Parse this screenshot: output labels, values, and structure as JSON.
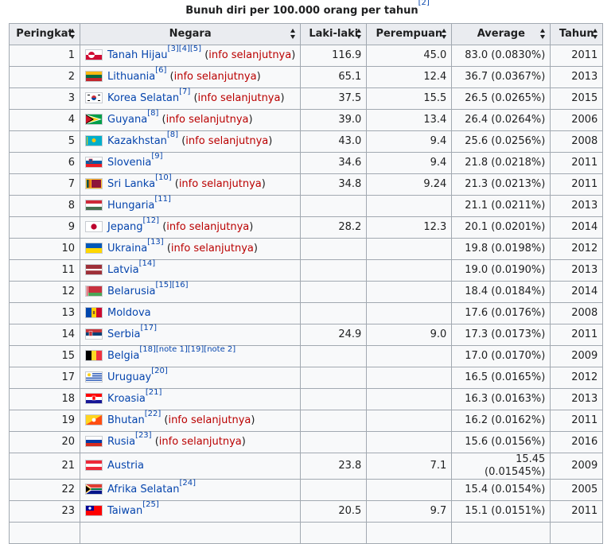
{
  "caption": {
    "text": "Bunuh diri per 100.000 orang per tahun",
    "ref": "[2]"
  },
  "columns": [
    "Peringkat",
    "Negara",
    "Laki-laki",
    "Perempuan",
    "Average",
    "Tahun"
  ],
  "info_text": "info selanjutnya",
  "rows": [
    {
      "rank": "1",
      "country": "Tanah Hijau",
      "refs": "[3][4][5]",
      "info": true,
      "male": "116.9",
      "female": "45.0",
      "avg": "83.0 (0.0830%)",
      "year": "2011",
      "flag": "greenland-flag"
    },
    {
      "rank": "2",
      "country": "Lithuania",
      "refs": "[6]",
      "info": true,
      "male": "65.1",
      "female": "12.4",
      "avg": "36.7 (0.0367%)",
      "year": "2013",
      "flag": "lithuania-flag"
    },
    {
      "rank": "3",
      "country": "Korea Selatan",
      "refs": "[7]",
      "info": true,
      "male": "37.5",
      "female": "15.5",
      "avg": "26.5 (0.0265%)",
      "year": "2015",
      "flag": "south-korea-flag"
    },
    {
      "rank": "4",
      "country": "Guyana",
      "refs": "[8]",
      "info": true,
      "male": "39.0",
      "female": "13.4",
      "avg": "26.4 (0.0264%)",
      "year": "2006",
      "flag": "guyana-flag"
    },
    {
      "rank": "5",
      "country": "Kazakhstan",
      "refs": "[8]",
      "info": true,
      "male": "43.0",
      "female": "9.4",
      "avg": "25.6 (0.0256%)",
      "year": "2008",
      "flag": "kazakhstan-flag"
    },
    {
      "rank": "6",
      "country": "Slovenia",
      "refs": "[9]",
      "info": false,
      "male": "34.6",
      "female": "9.4",
      "avg": "21.8 (0.0218%)",
      "year": "2011",
      "flag": "slovenia-flag"
    },
    {
      "rank": "7",
      "country": "Sri Lanka",
      "refs": "[10]",
      "info": true,
      "male": "34.8",
      "female": "9.24",
      "avg": "21.3 (0.0213%)",
      "year": "2011",
      "flag": "sri-lanka-flag"
    },
    {
      "rank": "8",
      "country": "Hungaria",
      "refs": "[11]",
      "info": false,
      "male": "",
      "female": "",
      "avg": "21.1 (0.0211%)",
      "year": "2013",
      "flag": "hungary-flag"
    },
    {
      "rank": "9",
      "country": "Jepang",
      "refs": "[12]",
      "info": true,
      "male": "28.2",
      "female": "12.3",
      "avg": "20.1 (0.0201%)",
      "year": "2014",
      "flag": "japan-flag"
    },
    {
      "rank": "10",
      "country": "Ukraina",
      "refs": "[13]",
      "info": true,
      "male": "",
      "female": "",
      "avg": "19.8 (0.0198%)",
      "year": "2012",
      "flag": "ukraine-flag"
    },
    {
      "rank": "11",
      "country": "Latvia",
      "refs": "[14]",
      "info": false,
      "male": "",
      "female": "",
      "avg": "19.0 (0.0190%)",
      "year": "2013",
      "flag": "latvia-flag"
    },
    {
      "rank": "12",
      "country": "Belarusia",
      "refs": "[15][16]",
      "info": false,
      "male": "",
      "female": "",
      "avg": "18.4 (0.0184%)",
      "year": "2014",
      "flag": "belarus-flag"
    },
    {
      "rank": "13",
      "country": "Moldova",
      "refs": "",
      "info": false,
      "male": "",
      "female": "",
      "avg": "17.6 (0.0176%)",
      "year": "2008",
      "flag": "moldova-flag"
    },
    {
      "rank": "14",
      "country": "Serbia",
      "refs": "[17]",
      "info": false,
      "male": "24.9",
      "female": "9.0",
      "avg": "17.3 (0.0173%)",
      "year": "2011",
      "flag": "serbia-flag"
    },
    {
      "rank": "15",
      "country": "Belgia",
      "refs": "[18][note 1][19][note 2]",
      "info": false,
      "male": "",
      "female": "",
      "avg": "17.0 (0.0170%)",
      "year": "2009",
      "flag": "belgium-flag"
    },
    {
      "rank": "17",
      "country": "Uruguay",
      "refs": "[20]",
      "info": false,
      "male": "",
      "female": "",
      "avg": "16.5 (0.0165%)",
      "year": "2012",
      "flag": "uruguay-flag"
    },
    {
      "rank": "18",
      "country": "Kroasia",
      "refs": "[21]",
      "info": false,
      "male": "",
      "female": "",
      "avg": "16.3 (0.0163%)",
      "year": "2013",
      "flag": "croatia-flag"
    },
    {
      "rank": "19",
      "country": "Bhutan",
      "refs": "[22]",
      "info": true,
      "male": "",
      "female": "",
      "avg": "16.2 (0.0162%)",
      "year": "2011",
      "flag": "bhutan-flag"
    },
    {
      "rank": "20",
      "country": "Rusia",
      "refs": "[23]",
      "info": true,
      "male": "",
      "female": "",
      "avg": "15.6 (0.0156%)",
      "year": "2016",
      "flag": "russia-flag"
    },
    {
      "rank": "21",
      "country": "Austria",
      "refs": "",
      "info": false,
      "male": "23.8",
      "female": "7.1",
      "avg": "15.45 (0.01545%)",
      "year": "2009",
      "flag": "austria-flag"
    },
    {
      "rank": "22",
      "country": "Afrika Selatan",
      "refs": "[24]",
      "info": false,
      "male": "",
      "female": "",
      "avg": "15.4 (0.0154%)",
      "year": "2005",
      "flag": "south-africa-flag"
    },
    {
      "rank": "23",
      "country": "Taiwan",
      "refs": "[25]",
      "info": false,
      "male": "20.5",
      "female": "9.7",
      "avg": "15.1 (0.0151%)",
      "year": "2011",
      "flag": "taiwan-flag"
    }
  ]
}
